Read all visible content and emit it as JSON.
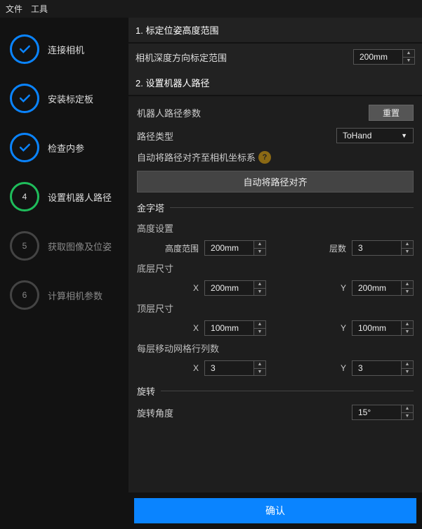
{
  "menu": {
    "file": "文件",
    "tools": "工具"
  },
  "steps": [
    {
      "label": "连接相机",
      "state": "done"
    },
    {
      "label": "安装标定板",
      "state": "done"
    },
    {
      "label": "检查内参",
      "state": "done"
    },
    {
      "label": "设置机器人路径",
      "state": "active",
      "num": "4"
    },
    {
      "label": "获取图像及位姿",
      "state": "pending",
      "num": "5"
    },
    {
      "label": "计算相机参数",
      "state": "pending",
      "num": "6"
    }
  ],
  "section1": {
    "title": "1. 标定位姿高度范围",
    "depth_label": "相机深度方向标定范围",
    "depth_value": "200mm"
  },
  "section2": {
    "title": "2. 设置机器人路径"
  },
  "params": {
    "title": "机器人路径参数",
    "reset": "重置",
    "path_type_label": "路径类型",
    "path_type_value": "ToHand",
    "auto_align_label": "自动将路径对齐至相机坐标系",
    "auto_align_button": "自动将路径对齐"
  },
  "pyramid": {
    "title": "金字塔",
    "height_settings": "高度设置",
    "height_range_label": "高度范围",
    "height_range_value": "200mm",
    "layers_label": "层数",
    "layers_value": "3",
    "bottom_size": "底层尺寸",
    "bottom_x": "200mm",
    "bottom_y": "200mm",
    "top_size": "顶层尺寸",
    "top_x": "100mm",
    "top_y": "100mm",
    "grid_label": "每层移动网格行列数",
    "grid_x": "3",
    "grid_y": "3",
    "x_label": "X",
    "y_label": "Y"
  },
  "rotation": {
    "title": "旋转",
    "angle_label": "旋转角度",
    "angle_value": "15°"
  },
  "confirm": "确认"
}
